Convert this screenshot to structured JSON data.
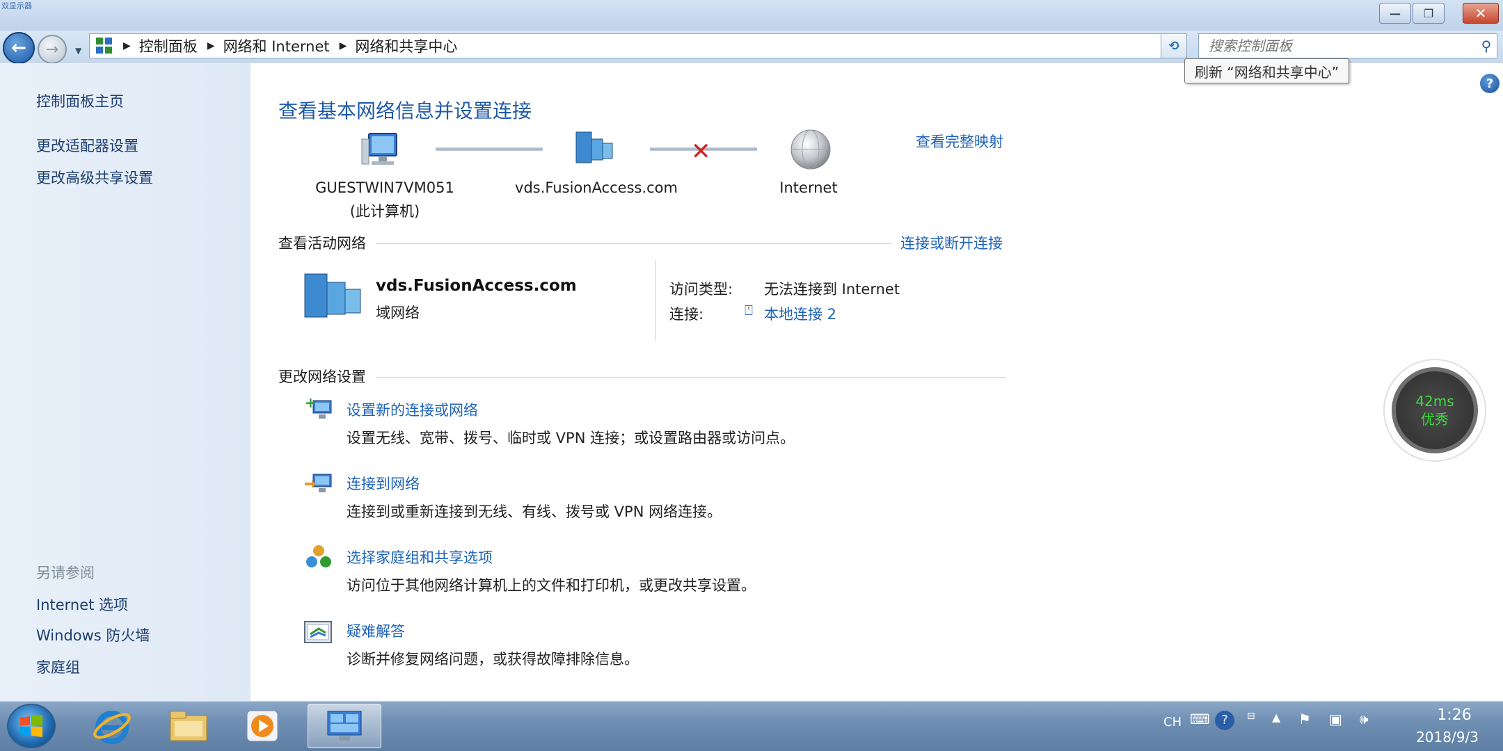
{
  "window": {
    "corner_text": "双显示器",
    "minimize_glyph": "—",
    "maximize_glyph": "❐",
    "close_glyph": "✕"
  },
  "nav": {
    "back_glyph": "←",
    "forward_glyph": "→",
    "breadcrumb": [
      "控制面板",
      "网络和 Internet",
      "网络和共享中心"
    ],
    "refresh_glyph": "⟲",
    "search_placeholder": "搜索控制面板",
    "tooltip": "刷新 “网络和共享中心”"
  },
  "sidebar": {
    "items": [
      {
        "label": "控制面板主页"
      },
      {
        "label": "更改适配器设置"
      },
      {
        "label": "更改高级共享设置"
      }
    ],
    "see_also_label": "另请参阅",
    "see_also": [
      {
        "label": "Internet 选项"
      },
      {
        "label": "Windows 防火墙"
      },
      {
        "label": "家庭组"
      }
    ]
  },
  "main": {
    "title": "查看基本网络信息并设置连接",
    "full_map_link": "查看完整映射",
    "nodes": [
      {
        "label": "GUESTWIN7VM051",
        "sublabel": "(此计算机)",
        "icon": "computer-icon"
      },
      {
        "label": "vds.FusionAccess.com",
        "icon": "domain-network-icon"
      },
      {
        "label": "Internet",
        "icon": "globe-icon"
      }
    ],
    "active_networks": {
      "heading": "查看活动网络",
      "action_link": "连接或断开连接",
      "network_name": "vds.FusionAccess.com",
      "network_type": "域网络",
      "access_type_label": "访问类型:",
      "access_type_value": "无法连接到 Internet",
      "connection_label": "连接:",
      "connection_value": "本地连接 2"
    },
    "change_settings": {
      "heading": "更改网络设置",
      "tasks": [
        {
          "title": "设置新的连接或网络",
          "desc": "设置无线、宽带、拨号、临时或 VPN 连接；或设置路由器或访问点。",
          "icon": "new-connection-icon"
        },
        {
          "title": "连接到网络",
          "desc": "连接到或重新连接到无线、有线、拨号或 VPN 网络连接。",
          "icon": "connect-network-icon"
        },
        {
          "title": "选择家庭组和共享选项",
          "desc": "访问位于其他网络计算机上的文件和打印机，或更改共享设置。",
          "icon": "homegroup-icon"
        },
        {
          "title": "疑难解答",
          "desc": "诊断并修复网络问题，或获得故障排除信息。",
          "icon": "troubleshoot-icon"
        }
      ]
    }
  },
  "ping_widget": {
    "latency": "42ms",
    "quality": "优秀"
  },
  "taskbar": {
    "apps": [
      "internet-explorer-icon",
      "file-explorer-icon",
      "media-player-icon",
      "control-panel-icon"
    ],
    "tray": {
      "lang": "CH",
      "time": "1:26",
      "date": "2018/9/3"
    }
  },
  "colors": {
    "link": "#1e63b8",
    "title": "#1e5aa8",
    "sidebar_bg": "#e4edf7",
    "disconnect": "#d6221b"
  }
}
